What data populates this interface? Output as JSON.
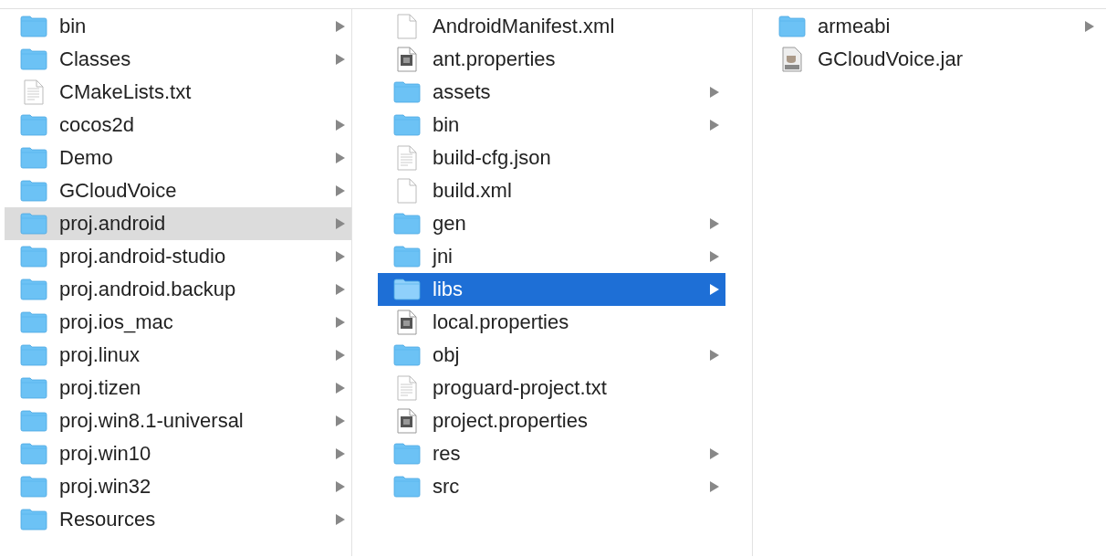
{
  "columns": [
    {
      "focused": false,
      "items": [
        {
          "name": "bin",
          "kind": "folder",
          "selected": false
        },
        {
          "name": "Classes",
          "kind": "folder",
          "selected": false
        },
        {
          "name": "CMakeLists.txt",
          "kind": "text",
          "selected": false
        },
        {
          "name": "cocos2d",
          "kind": "folder",
          "selected": false
        },
        {
          "name": "Demo",
          "kind": "folder",
          "selected": false
        },
        {
          "name": "GCloudVoice",
          "kind": "folder",
          "selected": false
        },
        {
          "name": "proj.android",
          "kind": "folder",
          "selected": true
        },
        {
          "name": "proj.android-studio",
          "kind": "folder",
          "selected": false
        },
        {
          "name": "proj.android.backup",
          "kind": "folder",
          "selected": false
        },
        {
          "name": "proj.ios_mac",
          "kind": "folder",
          "selected": false
        },
        {
          "name": "proj.linux",
          "kind": "folder",
          "selected": false
        },
        {
          "name": "proj.tizen",
          "kind": "folder",
          "selected": false
        },
        {
          "name": "proj.win8.1-universal",
          "kind": "folder",
          "selected": false
        },
        {
          "name": "proj.win10",
          "kind": "folder",
          "selected": false
        },
        {
          "name": "proj.win32",
          "kind": "folder",
          "selected": false
        },
        {
          "name": "Resources",
          "kind": "folder",
          "selected": false
        }
      ]
    },
    {
      "focused": true,
      "items": [
        {
          "name": "AndroidManifest.xml",
          "kind": "blank",
          "selected": false
        },
        {
          "name": "ant.properties",
          "kind": "properties",
          "selected": false
        },
        {
          "name": "assets",
          "kind": "folder",
          "selected": false
        },
        {
          "name": "bin",
          "kind": "folder",
          "selected": false
        },
        {
          "name": "build-cfg.json",
          "kind": "text",
          "selected": false
        },
        {
          "name": "build.xml",
          "kind": "blank",
          "selected": false
        },
        {
          "name": "gen",
          "kind": "folder",
          "selected": false
        },
        {
          "name": "jni",
          "kind": "folder",
          "selected": false
        },
        {
          "name": "libs",
          "kind": "folder",
          "selected": true
        },
        {
          "name": "local.properties",
          "kind": "properties",
          "selected": false
        },
        {
          "name": "obj",
          "kind": "folder",
          "selected": false
        },
        {
          "name": "proguard-project.txt",
          "kind": "text",
          "selected": false
        },
        {
          "name": "project.properties",
          "kind": "properties",
          "selected": false
        },
        {
          "name": "res",
          "kind": "folder",
          "selected": false
        },
        {
          "name": "src",
          "kind": "folder",
          "selected": false
        }
      ]
    },
    {
      "items": [
        {
          "name": "armeabi",
          "kind": "folder",
          "selected": false
        },
        {
          "name": "GCloudVoice.jar",
          "kind": "jar",
          "selected": false
        }
      ]
    }
  ]
}
